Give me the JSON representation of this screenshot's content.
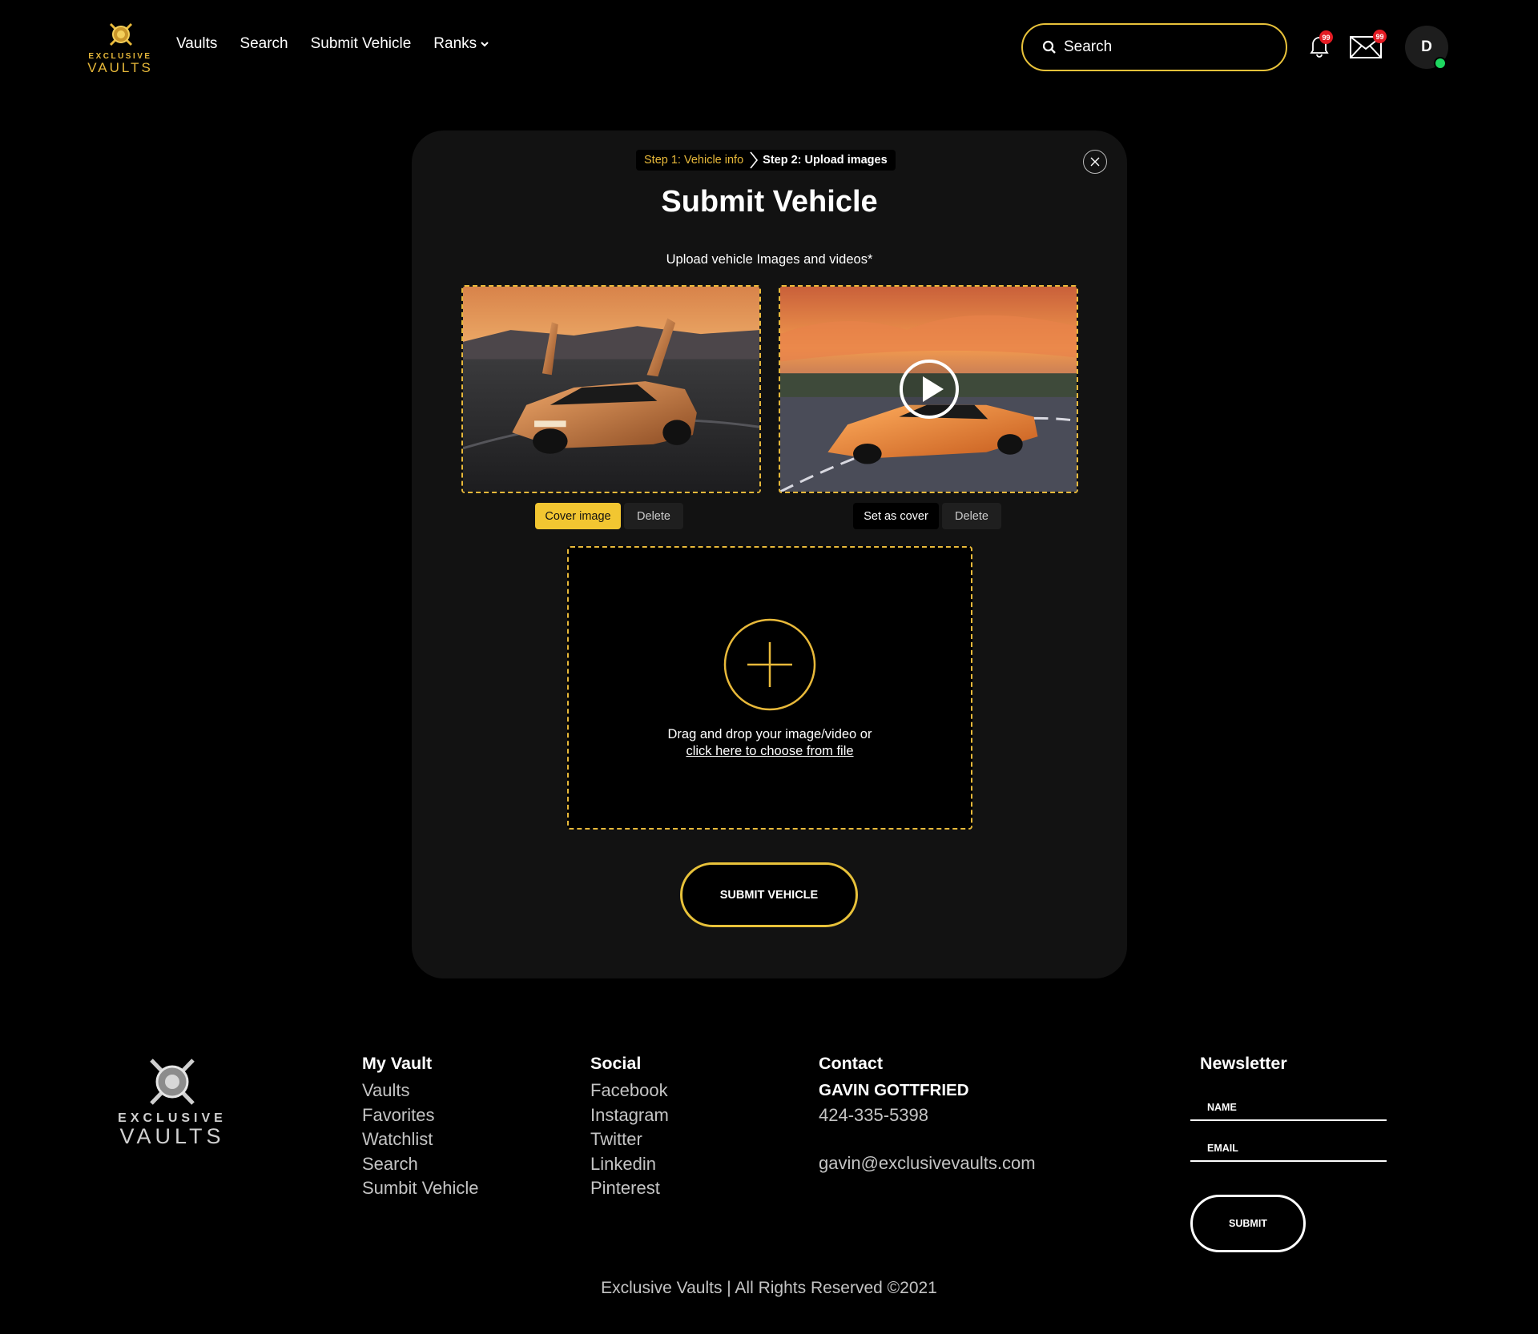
{
  "header": {
    "logo": {
      "line1": "EXCLUSIVE",
      "line2": "VAULTS"
    },
    "nav": [
      {
        "label": "Vaults"
      },
      {
        "label": "Search"
      },
      {
        "label": "Submit Vehicle"
      },
      {
        "label": "Ranks"
      }
    ],
    "search_placeholder": "Search",
    "notifications_badge": "99",
    "messages_badge": "99",
    "avatar_initial": "D",
    "accent_color": "#e8c23a",
    "online_color": "#1ed760"
  },
  "modal": {
    "step1": "Step 1: Vehicle info",
    "step2": "Step 2: Upload images",
    "title": "Submit Vehicle",
    "upload_label": "Upload vehicle Images and videos*",
    "media": [
      {
        "kind": "image",
        "primary_action": "Cover image",
        "delete_label": "Delete"
      },
      {
        "kind": "video",
        "primary_action": "Set as cover",
        "delete_label": "Delete"
      }
    ],
    "dropzone": {
      "text": "Drag and drop your image/video or",
      "link": "click here to choose from file"
    },
    "submit_label": "SUBMIT VEHICLE"
  },
  "footer": {
    "logo": {
      "line1": "EXCLUSIVE",
      "line2": "VAULTS"
    },
    "my_vault": {
      "title": "My Vault",
      "links": [
        "Vaults",
        "Favorites",
        "Watchlist",
        "Search",
        "Sumbit Vehicle"
      ]
    },
    "social": {
      "title": "Social",
      "links": [
        "Facebook",
        "Instagram",
        "Twitter",
        "Linkedin",
        "Pinterest"
      ]
    },
    "contact": {
      "title": "Contact",
      "name": "GAVIN GOTTFRIED",
      "phone": "424-335-5398",
      "email": "gavin@exclusivevaults.com"
    },
    "newsletter": {
      "title": "Newsletter",
      "name_placeholder": "NAME",
      "email_placeholder": "EMAIL",
      "submit_label": "SUBMIT"
    },
    "copyright": "Exclusive Vaults | All Rights Reserved ©2021"
  }
}
